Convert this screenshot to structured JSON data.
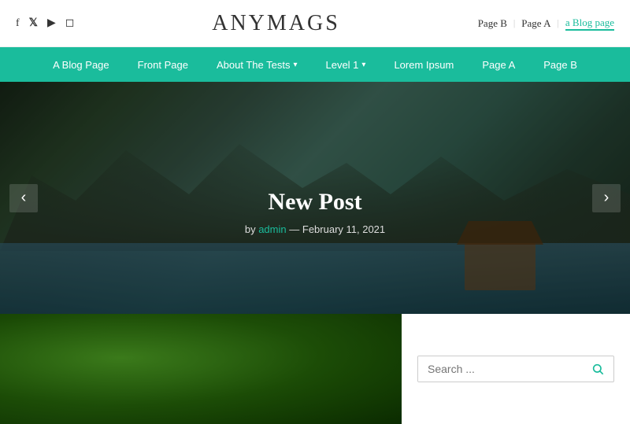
{
  "site": {
    "title": "ANYMAGS"
  },
  "top_social": {
    "icons": [
      {
        "name": "facebook",
        "symbol": "f"
      },
      {
        "name": "twitter",
        "symbol": "𝕏"
      },
      {
        "name": "youtube",
        "symbol": "▶"
      },
      {
        "name": "instagram",
        "symbol": "◻"
      }
    ]
  },
  "top_nav": {
    "items": [
      {
        "label": "Page B",
        "active": false
      },
      {
        "label": "Page A",
        "active": false
      },
      {
        "label": "a Blog page",
        "active": true
      }
    ]
  },
  "nav": {
    "items": [
      {
        "label": "A Blog Page",
        "has_arrow": false
      },
      {
        "label": "Front Page",
        "has_arrow": false
      },
      {
        "label": "About The Tests",
        "has_arrow": true
      },
      {
        "label": "Level 1",
        "has_arrow": true
      },
      {
        "label": "Lorem Ipsum",
        "has_arrow": false
      },
      {
        "label": "Page A",
        "has_arrow": false
      },
      {
        "label": "Page B",
        "has_arrow": false
      }
    ]
  },
  "hero": {
    "title": "New Post",
    "meta_by": "by",
    "author": "admin",
    "date": "February 11, 2021"
  },
  "search": {
    "placeholder": "Search ...",
    "label": "Search _"
  },
  "colors": {
    "teal": "#1abc9c"
  }
}
